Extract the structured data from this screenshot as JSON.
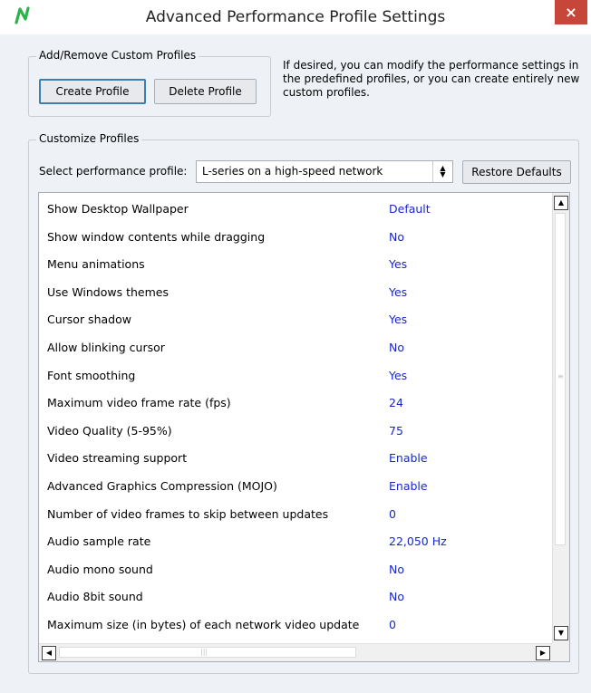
{
  "window": {
    "title": "Advanced Performance Profile Settings",
    "close_label": "×",
    "logo_icon": "n-logo-icon",
    "logo_color": "#2cb34a",
    "close_bg": "#c7463a"
  },
  "custom_profiles": {
    "legend": "Add/Remove Custom Profiles",
    "create_label": "Create Profile",
    "delete_label": "Delete Profile",
    "description": "If desired, you can modify the performance settings in the predefined profiles, or you can create entirely new custom profiles."
  },
  "customize": {
    "legend": "Customize Profiles",
    "select_label": "Select performance profile:",
    "selected_profile": "L-series on a high-speed network",
    "restore_label": "Restore Defaults"
  },
  "settings": [
    {
      "label": "Show Desktop Wallpaper",
      "value": "Default"
    },
    {
      "label": "Show window contents while dragging",
      "value": "No"
    },
    {
      "label": "Menu animations",
      "value": "Yes"
    },
    {
      "label": "Use Windows themes",
      "value": "Yes"
    },
    {
      "label": "Cursor shadow",
      "value": "Yes"
    },
    {
      "label": "Allow blinking cursor",
      "value": "No"
    },
    {
      "label": "Font smoothing",
      "value": "Yes"
    },
    {
      "label": "Maximum video frame rate (fps)",
      "value": "24"
    },
    {
      "label": "Video Quality (5-95%)",
      "value": "75"
    },
    {
      "label": "Video streaming support",
      "value": "Enable"
    },
    {
      "label": "Advanced Graphics Compression (MOJO)",
      "value": "Enable"
    },
    {
      "label": "Number of video frames to skip between updates",
      "value": "0"
    },
    {
      "label": "Audio sample rate",
      "value": "22,050 Hz"
    },
    {
      "label": "Audio mono sound",
      "value": "No"
    },
    {
      "label": "Audio 8bit sound",
      "value": "No"
    },
    {
      "label": "Maximum size (in bytes) of each network video update",
      "value": "0"
    }
  ],
  "colors": {
    "value_text": "#1a27c6",
    "dialog_bg": "#eef1f5"
  }
}
